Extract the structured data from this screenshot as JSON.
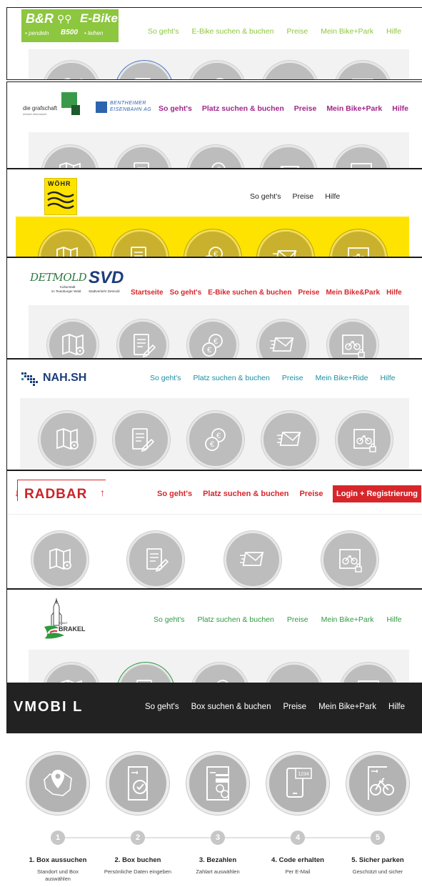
{
  "colors": {
    "br_green": "#8dc63f",
    "grafschaft_purple": "#a0268a",
    "woehr_yellow": "#ffe300",
    "detmold_red": "#d7262b",
    "nahsh_teal": "#1a8fa3",
    "radbar_red": "#d7262b",
    "brakel_green": "#2f9a3f",
    "vmobil_black": "#222222"
  },
  "panels": {
    "br": {
      "logo_main": "B&R",
      "logo_bike": "E-Bike",
      "logo_sub1": "• pendeln",
      "logo_sub2": "B500",
      "logo_sub3": "• leihen",
      "nav": [
        "So geht's",
        "E-Bike suchen & buchen",
        "Preise",
        "Mein Bike+Park",
        "Hilfe"
      ]
    },
    "grafschaft": {
      "logo_text": "die grafschaft",
      "logo_sub": "einfach lebenswert",
      "partner_1": "BENTHEIMER",
      "partner_2": "EISENBAHN AG",
      "nav": [
        "So geht's",
        "Platz suchen & buchen",
        "Preise",
        "Mein Bike+Park",
        "Hilfe"
      ]
    },
    "woehr": {
      "logo_text": "WÖHR",
      "nav": [
        "So geht's",
        "Preise",
        "Hilfe"
      ]
    },
    "detmold": {
      "logo_text": "DETMOLD",
      "logo_sub1": "Kulturstadt",
      "logo_sub2": "im Teutoburger Wald",
      "partner": "SVD",
      "partner_sub": "Stadtverkehr Detmold",
      "nav": [
        "Startseite",
        "So geht's",
        "E-Bike suchen & buchen",
        "Preise",
        "Mein Bike&Park",
        "Hilfe"
      ]
    },
    "nahsh": {
      "logo_text": "NAH.SH",
      "nav": [
        "So geht's",
        "Platz suchen & buchen",
        "Preise",
        "Mein Bike+Ride",
        "Hilfe"
      ]
    },
    "radbar": {
      "logo_text": "RADBAR",
      "nav": [
        "So geht's",
        "Platz suchen & buchen",
        "Preise"
      ],
      "login_button": "Login + Registrierung"
    },
    "brakel": {
      "logo_top": "STADT",
      "logo_text": "BRAKEL",
      "nav": [
        "So geht's",
        "Platz suchen & buchen",
        "Preise",
        "Mein Bike+Park",
        "Hilfe"
      ]
    },
    "vmobil": {
      "logo_text": "VMOBI L",
      "nav": [
        "So geht's",
        "Box suchen & buchen",
        "Preise",
        "Mein Bike+Park",
        "Hilfe"
      ],
      "code_label": "1234",
      "steps": [
        {
          "num": "1",
          "title": "1. Box aussuchen",
          "sub": "Standort und Box auswählen",
          "icon": "map-pin-icon"
        },
        {
          "num": "2",
          "title": "2. Box buchen",
          "sub": "Persönliche Daten eingeben",
          "icon": "door-check-icon"
        },
        {
          "num": "3",
          "title": "3. Bezahlen",
          "sub": "Zahlart auswählen",
          "icon": "card-coins-icon"
        },
        {
          "num": "4",
          "title": "4. Code erhalten",
          "sub": "Per E-Mail",
          "icon": "phone-code-icon"
        },
        {
          "num": "5",
          "title": "5. Sicher parken",
          "sub": "Geschützt und sicher",
          "icon": "bike-box-icon"
        }
      ]
    }
  }
}
